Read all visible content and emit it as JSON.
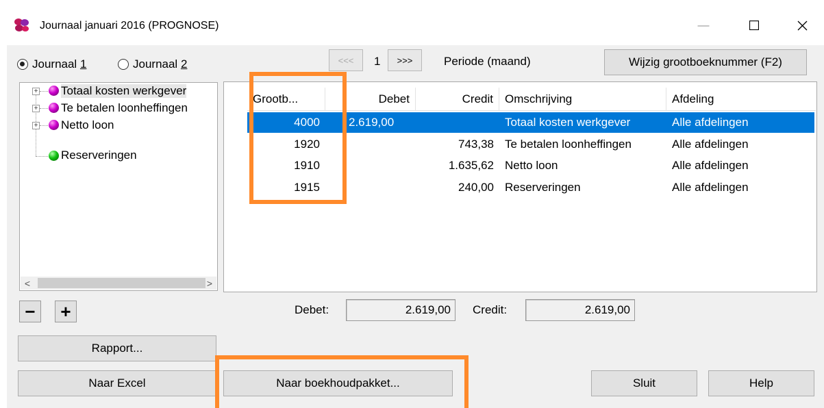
{
  "window": {
    "title": "Journaal januari 2016 (PROGNOSE)",
    "minimize": "—",
    "maximize": "☐",
    "close": "✕"
  },
  "journal": {
    "option1": {
      "prefix": "Journaal ",
      "key": "1",
      "selected": true
    },
    "option2": {
      "prefix": "Journaal ",
      "key": "2",
      "selected": false
    }
  },
  "pager": {
    "prev": "<<<",
    "page": "1",
    "next": ">>>",
    "period": "Periode (maand)"
  },
  "buttons": {
    "change_ledger": "Wijzig grootboeknummer (F2)",
    "report": "Rapport...",
    "to_excel": "Naar Excel",
    "to_accounting": "Naar boekhoudpakket...",
    "close": "Sluit",
    "help": "Help",
    "collapse": "−",
    "expand": "+"
  },
  "tree": {
    "items": [
      {
        "label": "Totaal kosten werkgever",
        "color": "purple",
        "expandable": true
      },
      {
        "label": "Te betalen loonheffingen",
        "color": "purple",
        "expandable": true
      },
      {
        "label": "Netto loon",
        "color": "purple",
        "expandable": true
      },
      {
        "label": "Reserveringen",
        "color": "green",
        "expandable": false
      }
    ],
    "scroll_left": "<",
    "scroll_right": ">"
  },
  "grid": {
    "columns": [
      "Grootb...",
      "Debet",
      "Credit",
      "Omschrijving",
      "Afdeling"
    ],
    "rows": [
      {
        "account": "4000",
        "debet": "2.619,00",
        "credit": "",
        "description": "Totaal kosten werkgever",
        "department": "Alle afdelingen",
        "selected": true
      },
      {
        "account": "1920",
        "debet": "",
        "credit": "743,38",
        "description": "Te betalen loonheffingen",
        "department": "Alle afdelingen",
        "selected": false
      },
      {
        "account": "1910",
        "debet": "",
        "credit": "1.635,62",
        "description": "Netto loon",
        "department": "Alle afdelingen",
        "selected": false
      },
      {
        "account": "1915",
        "debet": "",
        "credit": "240,00",
        "description": "Reserveringen",
        "department": "Alle afdelingen",
        "selected": false
      }
    ]
  },
  "totals": {
    "debet_label": "Debet:",
    "debet_value": "2.619,00",
    "credit_label": "Credit:",
    "credit_value": "2.619,00"
  },
  "colors": {
    "selection": "#0078d7",
    "highlight": "#ff8a2b",
    "dialog_bg": "#f0f0f0"
  }
}
